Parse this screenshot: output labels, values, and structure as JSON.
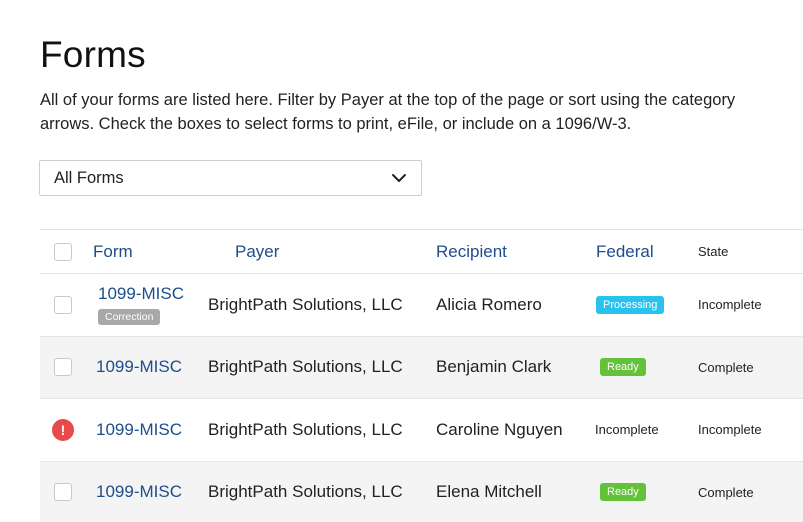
{
  "page": {
    "title": "Forms",
    "description": "All of your forms are listed here. Filter by Payer at the top of the page or sort using the category arrows. Check the boxes to select forms to print, eFile, or include on a 1096/W-3."
  },
  "filter": {
    "selected": "All Forms",
    "icon": "chevron-down-icon"
  },
  "table": {
    "headers": {
      "form": "Form",
      "payer": "Payer",
      "recipient": "Recipient",
      "federal": "Federal",
      "state": "State"
    },
    "rows": [
      {
        "form": "1099-MISC",
        "tag": "Correction",
        "payer": "BrightPath Solutions, LLC",
        "recipient": "Alicia Romero",
        "federal": "Processing",
        "state": "Incomplete"
      },
      {
        "form": "1099-MISC",
        "payer": "BrightPath Solutions, LLC",
        "recipient": "Benjamin Clark",
        "federal": "Ready",
        "state": "Complete"
      },
      {
        "form": "1099-MISC",
        "error_icon": "!",
        "payer": "BrightPath Solutions, LLC",
        "recipient": "Caroline Nguyen",
        "federal": "Incomplete",
        "state": "Incomplete"
      },
      {
        "form": "1099-MISC",
        "payer": "BrightPath Solutions, LLC",
        "recipient": "Elena Mitchell",
        "federal": "Ready",
        "state": "Complete"
      }
    ]
  },
  "colors": {
    "link": "#1e4d8c",
    "processing": "#28c2ef",
    "ready": "#63c23a",
    "error": "#e84a4a",
    "correction": "#a8a8a8",
    "row_shade": "#f4f4f4"
  }
}
